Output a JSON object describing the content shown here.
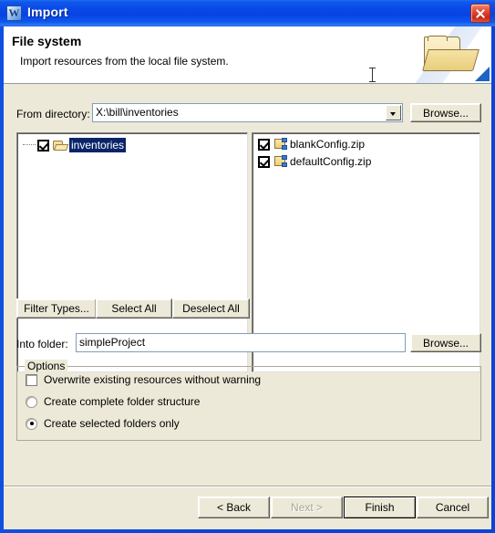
{
  "window": {
    "title": "Import",
    "title_icon": "app-w-icon",
    "close_label": "close-icon"
  },
  "header": {
    "title": "File system",
    "subtitle": "Import resources from the local file system.",
    "banner_icon": "open-folder-icon"
  },
  "source": {
    "label": "From directory:",
    "value": "X:\\bill\\inventories",
    "placeholder": "",
    "dropdown_icon": "chevron-down-icon",
    "browse_label": "Browse..."
  },
  "tree": {
    "items": [
      {
        "label": "inventories",
        "checked": true,
        "selected": true,
        "icon": "open-folder-icon"
      }
    ]
  },
  "files": {
    "items": [
      {
        "label": "blankConfig.zip",
        "checked": true,
        "icon": "zip-file-icon"
      },
      {
        "label": "defaultConfig.zip",
        "checked": true,
        "icon": "zip-file-icon"
      }
    ]
  },
  "selection_buttons": {
    "filter_types": "Filter Types...",
    "select_all": "Select All",
    "deselect_all": "Deselect All"
  },
  "destination": {
    "label": "Into folder:",
    "value": "simpleProject",
    "placeholder": "",
    "browse_label": "Browse..."
  },
  "options": {
    "title": "Options",
    "overwrite": {
      "label": "Overwrite existing resources without warning",
      "checked": false
    },
    "create_complete": {
      "label": "Create complete folder structure",
      "selected": false
    },
    "create_selected": {
      "label": "Create selected folders only",
      "selected": true
    }
  },
  "footer": {
    "back": "< Back",
    "next": "Next >",
    "next_disabled": true,
    "finish": "Finish",
    "finish_default": true,
    "cancel": "Cancel"
  },
  "colors": {
    "titlebar": "#0a44d8",
    "dialog_bg": "#ece9d8",
    "selection": "#0a246a",
    "close_button": "#c7281a"
  }
}
